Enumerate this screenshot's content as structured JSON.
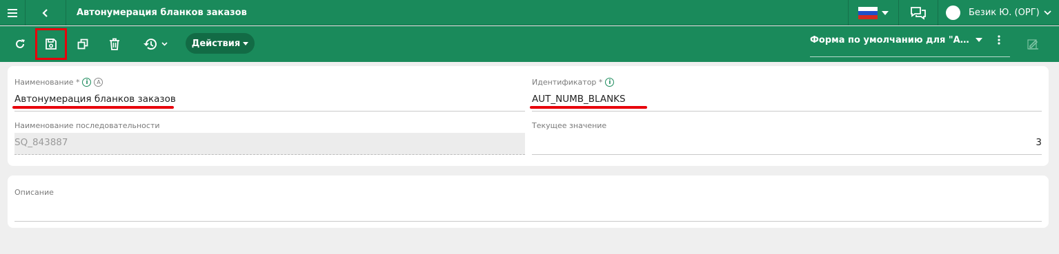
{
  "header": {
    "title": "Автонумерация бланков заказов",
    "user_name": "Безик Ю. (ОРГ)"
  },
  "toolbar": {
    "actions_label": "Действия",
    "form_label": "Форма по умолчанию для \"Автонумерация бланков заказов\""
  },
  "form": {
    "name_label": "Наименование *",
    "name_value": "Автонумерация бланков заказов",
    "identifier_label": "Идентификатор *",
    "identifier_value": "AUT_NUMB_BLANKS",
    "sequence_label": "Наименование последовательности",
    "sequence_value": "SQ_843887",
    "current_label": "Текущее значение",
    "current_value": "3",
    "description_label": "Описание",
    "description_value": ""
  },
  "icons": {
    "info_glyph": "i",
    "auto_glyph": "A"
  },
  "colors": {
    "brand": "#1a8a5b",
    "highlight": "#e8000b"
  }
}
